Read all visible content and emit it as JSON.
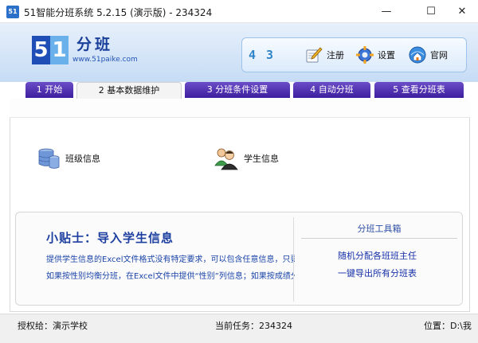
{
  "window": {
    "title": "51智能分班系统 5.2.15 (演示版) - 234324",
    "icon_label": "51",
    "min_glyph": "—",
    "max_glyph": "☐",
    "close_glyph": "✕"
  },
  "header": {
    "logo_digit_5": "5",
    "logo_digit_1": "1",
    "logo_text": "分班",
    "logo_url": "www.51paike.com",
    "counter": "4 3",
    "buttons": [
      {
        "label": "注册",
        "icon": "pencil-icon"
      },
      {
        "label": "设置",
        "icon": "gear-icon"
      },
      {
        "label": "官网",
        "icon": "globe-home-icon"
      }
    ]
  },
  "tabs": [
    {
      "label": "1 开始",
      "active": false
    },
    {
      "label": "2 基本数据维护",
      "active": true
    },
    {
      "label": "3 分班条件设置",
      "active": false
    },
    {
      "label": "4 自动分班",
      "active": false
    },
    {
      "label": "5 查看分班表",
      "active": false
    }
  ],
  "entries": {
    "class_info": "班级信息",
    "student_info": "学生信息"
  },
  "tips": {
    "title": "小贴士：导入学生信息",
    "line1": "提供学生信息的Excel文件格式没有特定要求，可以包含任意信息，只要存在“",
    "line2": "如果按性别均衡分班，在Excel文件中提供“性别”列信息；如果按成绩分班，"
  },
  "toolbox": {
    "title": "分班工具箱",
    "links": [
      "随机分配各班班主任",
      "一键导出所有分班表"
    ]
  },
  "status": {
    "licensee": "授权给：演示学校",
    "current_task": "当前任务：234324",
    "location": "位置：D:\\我"
  },
  "colors": {
    "tab_bg": "#4a2db0",
    "header_bg": "#cfe1f6",
    "link_blue": "#1c45a8"
  }
}
